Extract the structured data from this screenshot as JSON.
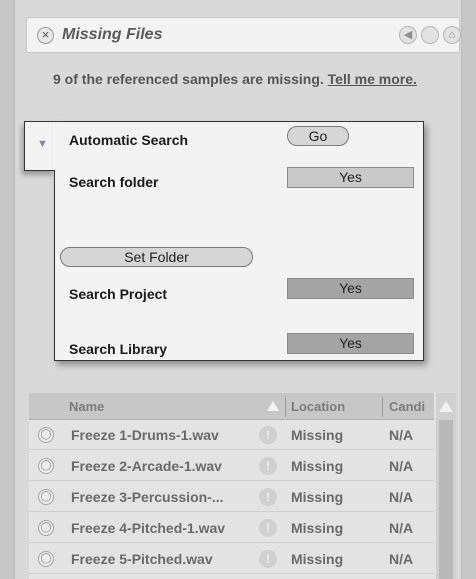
{
  "window": {
    "title": "Missing Files"
  },
  "titlebar": {
    "close_glyph": "×",
    "back_glyph": "◀",
    "forward_glyph": "",
    "home_glyph": "⌂"
  },
  "intro": {
    "text": "9 of the referenced samples are missing.",
    "link": "Tell me more."
  },
  "search": {
    "automatic_search_label": "Automatic Search",
    "go_label": "Go",
    "search_folder_label": "Search folder",
    "search_folder_value": "Yes",
    "set_folder_label": "Set Folder",
    "search_project_label": "Search Project",
    "search_project_value": "Yes",
    "search_library_label": "Search Library",
    "search_library_value": "Yes"
  },
  "table": {
    "columns": [
      "Name",
      "Location",
      "Candi"
    ],
    "rows": [
      {
        "name": "Freeze 1-Drums-1.wav",
        "location": "Missing",
        "candidates": "N/A"
      },
      {
        "name": "Freeze 2-Arcade-1.wav",
        "location": "Missing",
        "candidates": "N/A"
      },
      {
        "name": "Freeze 3-Percussion-...",
        "location": "Missing",
        "candidates": "N/A"
      },
      {
        "name": "Freeze 4-Pitched-1.wav",
        "location": "Missing",
        "candidates": "N/A"
      },
      {
        "name": "Freeze 5-Pitched.wav",
        "location": "Missing",
        "candidates": "N/A"
      }
    ]
  },
  "icons": {
    "close": "close-icon",
    "back": "back-arrow-icon",
    "forward": "forward-icon",
    "home": "home-icon",
    "disclosure": "disclosure-triangle-icon",
    "preview": "preview-icon",
    "warning": "warning-icon",
    "sort": "sort-ascending-icon",
    "scroll_up": "scroll-up-icon"
  },
  "colors": {
    "panel_bg": "#f3f3f3",
    "window_bg": "#d9d9d9",
    "toggle_on": "#a4a4a4"
  }
}
